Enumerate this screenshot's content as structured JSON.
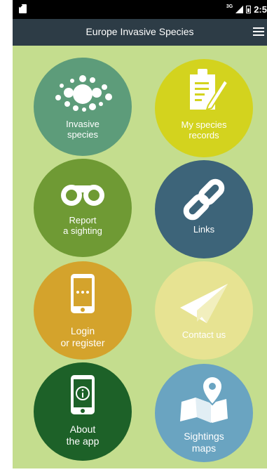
{
  "status_bar": {
    "network": "3G",
    "time": "2:5"
  },
  "header": {
    "title": "Europe Invasive Species"
  },
  "menu": [
    {
      "label": "Invasive\nspecies",
      "icon": "dots-cluster-icon",
      "color": "#5d9c7a"
    },
    {
      "label": "My species\nrecords",
      "icon": "clipboard-pen-icon",
      "color": "#d3d31e"
    },
    {
      "label": "Report\na sighting",
      "icon": "binoculars-icon",
      "color": "#6f9a34"
    },
    {
      "label": "Links",
      "icon": "chain-link-icon",
      "color": "#3d6479"
    },
    {
      "label": "Login\nor register",
      "icon": "smartphone-icon",
      "color": "#d4a32c"
    },
    {
      "label": "Contact us",
      "icon": "paper-plane-icon",
      "color": "#e7e392"
    },
    {
      "label": "About\nthe app",
      "icon": "phone-info-icon",
      "color": "#1d6128"
    },
    {
      "label": "Sightings\nmaps",
      "icon": "map-pin-icon",
      "color": "#6aa4c1"
    }
  ]
}
